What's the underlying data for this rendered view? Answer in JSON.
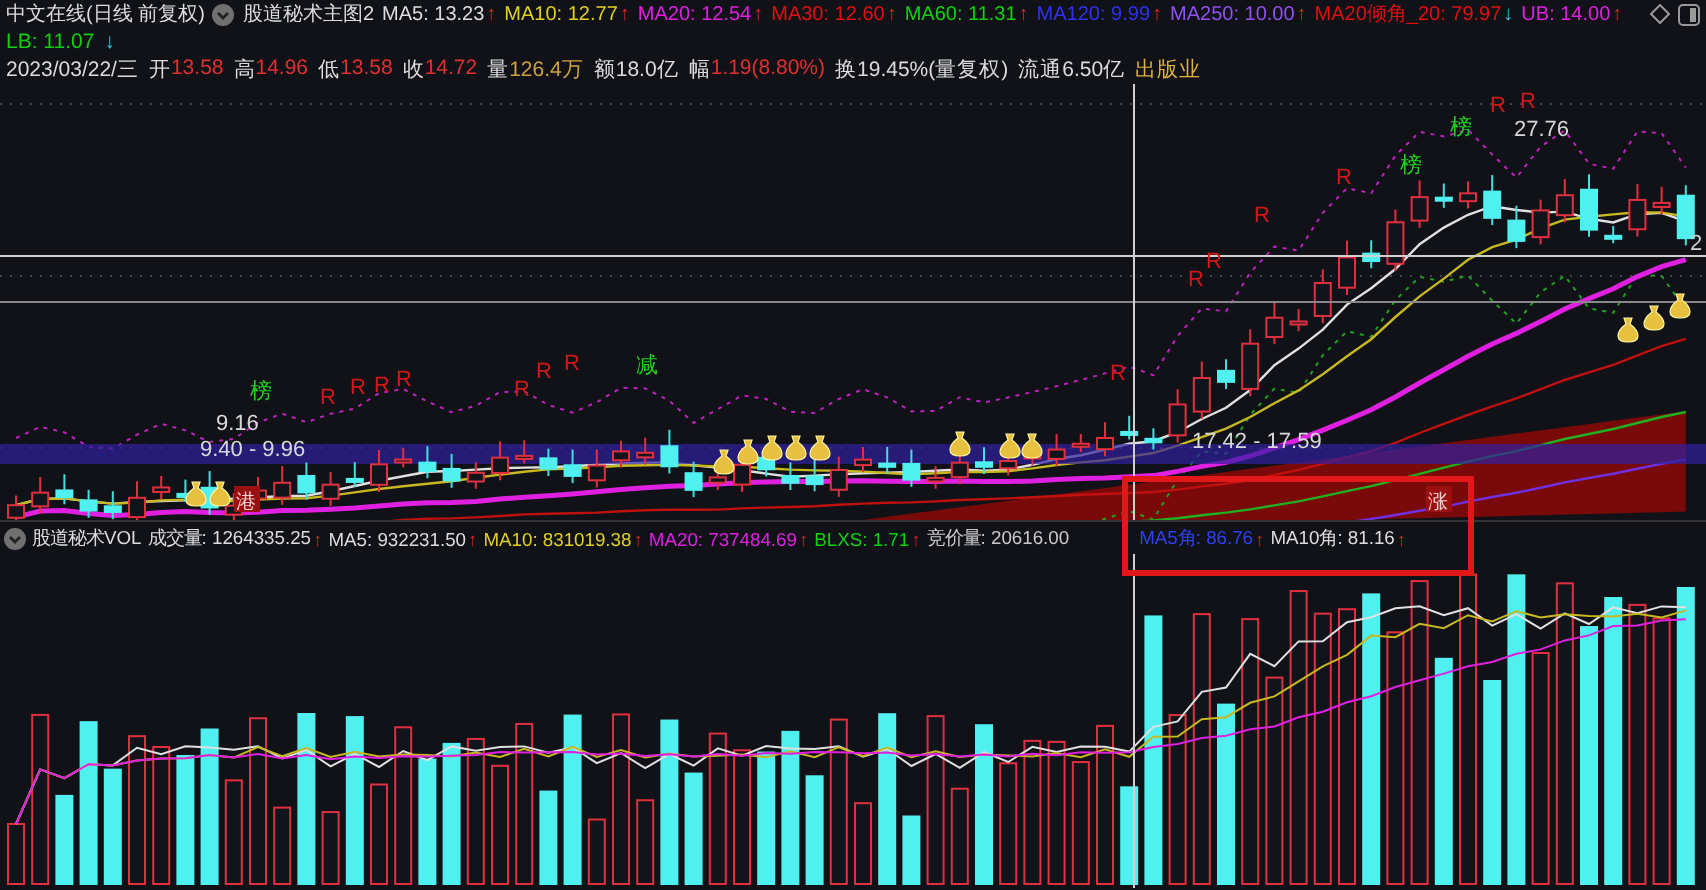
{
  "header": {
    "title": "中文在线(日线 前复权)",
    "study": "股道秘术主图2",
    "indicators": [
      {
        "text": "MA5: 13.23",
        "arrow": "↑",
        "rising": true,
        "color": "#dcdcdc"
      },
      {
        "text": "MA10: 12.77",
        "arrow": "↑",
        "rising": true,
        "color": "#e0d020"
      },
      {
        "text": "MA20: 12.54",
        "arrow": "↑",
        "rising": true,
        "color": "#e020e0"
      },
      {
        "text": "MA30: 12.60",
        "arrow": "↑",
        "rising": true,
        "color": "#e01010"
      },
      {
        "text": "MA60: 11.31",
        "arrow": "↑",
        "rising": true,
        "color": "#10d010"
      },
      {
        "text": "MA120: 9.99",
        "arrow": "↑",
        "rising": true,
        "color": "#3030f0"
      },
      {
        "text": "MA250: 10.00",
        "arrow": "↑",
        "rising": true,
        "color": "#9050f0"
      },
      {
        "text": "MA20倾角_20: 79.97",
        "arrow": "↓",
        "rising": false,
        "color": "#e01010"
      },
      {
        "text": "UB: 14.00",
        "arrow": "↑",
        "rising": true,
        "color": "#e020e0"
      }
    ],
    "lb": {
      "text": "LB: 11.07",
      "arrow": "↓",
      "rising": false,
      "color": "#10d010"
    }
  },
  "quote": [
    {
      "label": "2023/03/22/三",
      "color": "#dcdcdc"
    },
    {
      "label": "开",
      "value": "13.58",
      "color": "#e03030"
    },
    {
      "label": "高",
      "value": "14.96",
      "color": "#e03030"
    },
    {
      "label": "低",
      "value": "13.58",
      "color": "#e03030"
    },
    {
      "label": "收",
      "value": "14.72",
      "color": "#e03030"
    },
    {
      "label": "量",
      "value": "126.4万",
      "color": "#d0a040"
    },
    {
      "label": "额",
      "value": "18.0亿",
      "color": "#dcdcdc"
    },
    {
      "label": "幅",
      "value": "1.19(8.80%)",
      "color": "#e03030"
    },
    {
      "label": "换",
      "value": "19.45%(量复权)",
      "color": "#dcdcdc"
    },
    {
      "label": "流通",
      "value": "6.50亿",
      "color": "#dcdcdc"
    },
    {
      "label": "出版业",
      "color": "#e0b040"
    }
  ],
  "main_chart": {
    "markers": [
      {
        "text": "R",
        "kind": "signal"
      },
      {
        "text": "R",
        "kind": "signal"
      },
      {
        "text": "R",
        "kind": "signal"
      },
      {
        "text": "R",
        "kind": "signal"
      },
      {
        "text": "R",
        "kind": "signal"
      },
      {
        "text": "R",
        "kind": "signal"
      },
      {
        "text": "R",
        "kind": "signal"
      },
      {
        "text": "R",
        "kind": "signal"
      },
      {
        "text": "R",
        "kind": "signal"
      },
      {
        "text": "R",
        "kind": "signal"
      },
      {
        "text": "R",
        "kind": "signal"
      },
      {
        "text": "R",
        "kind": "signal"
      },
      {
        "text": "R",
        "kind": "signal"
      },
      {
        "text": "R",
        "kind": "signal"
      },
      {
        "text": "榜",
        "kind": "rank"
      },
      {
        "text": "榜",
        "kind": "rank"
      },
      {
        "text": "榜",
        "kind": "rank"
      },
      {
        "text": "减",
        "kind": "rank"
      }
    ],
    "price_labels": [
      "17.42 - 17.59",
      "27.76",
      "9.40 - 9.96",
      "9.16"
    ],
    "tags": [
      "港",
      "涨"
    ],
    "axis_label": "2"
  },
  "volume_panel": {
    "study": "股道秘术VOL",
    "indicators": [
      {
        "text": "成交量: 1264335.25",
        "arrow": "↑",
        "rising": true,
        "color": "#dcdcdc"
      },
      {
        "text": "MA5: 932231.50",
        "arrow": "↑",
        "rising": true,
        "color": "#dcdcdc"
      },
      {
        "text": "MA10: 831019.38",
        "arrow": "↑",
        "rising": true,
        "color": "#e0d020"
      },
      {
        "text": "MA20: 737484.69",
        "arrow": "↑",
        "rising": true,
        "color": "#e020e0"
      },
      {
        "text": "BLXS: 1.71",
        "arrow": "↑",
        "rising": true,
        "color": "#10d010"
      },
      {
        "text": "竞价量: 20616.00",
        "color": "#c8c8c8"
      },
      {
        "text": "MA5角: 86.76",
        "arrow": "↑",
        "rising": true,
        "color": "#3040f0"
      },
      {
        "text": "MA10角: 81.16",
        "arrow": "↑",
        "rising": true,
        "color": "#dcdcdc"
      }
    ]
  }
}
